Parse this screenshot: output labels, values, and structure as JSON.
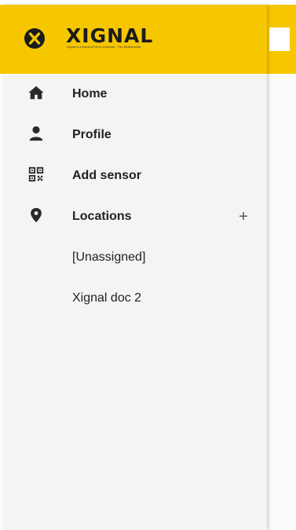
{
  "brand": {
    "name": "XIGNAL",
    "tagline": "Xignal is a brand of Dirrix Systems - The Netherlands",
    "color": "#f6c700"
  },
  "nav": {
    "home": {
      "label": "Home",
      "icon": "home-icon"
    },
    "profile": {
      "label": "Profile",
      "icon": "person-icon"
    },
    "add_sensor": {
      "label": "Add sensor",
      "icon": "qr-code-icon"
    },
    "locations": {
      "label": "Locations",
      "icon": "location-pin-icon",
      "add_symbol": "+",
      "items": [
        {
          "label": "[Unassigned]"
        },
        {
          "label": "Xignal doc 2"
        }
      ]
    }
  }
}
